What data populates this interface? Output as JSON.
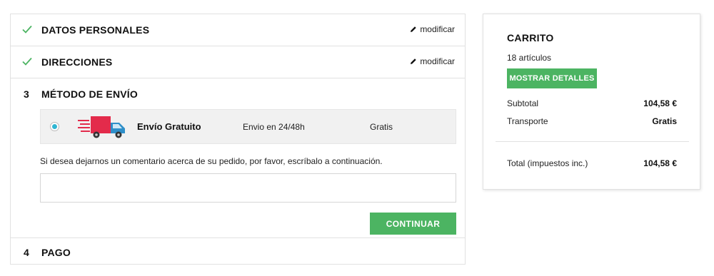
{
  "steps": [
    {
      "label": "DATOS PERSONALES",
      "status": "done",
      "action": "modificar"
    },
    {
      "label": "DIRECCIONES",
      "status": "done",
      "action": "modificar"
    },
    {
      "number": "3",
      "label": "MÉTODO DE ENVÍO",
      "status": "current"
    },
    {
      "number": "4",
      "label": "PAGO",
      "status": "pending"
    }
  ],
  "shipping": {
    "carrier_name": "Envío Gratuito",
    "delay": "Envio en 24/48h",
    "price": "Gratis",
    "selected": true,
    "icon": "delivery-truck-icon",
    "comment_label": "Si desea dejarnos un comentario acerca de su pedido, por favor, escríbalo a continuación.",
    "comment_value": "",
    "continue_label": "CONTINUAR"
  },
  "cart": {
    "title": "CARRITO",
    "item_count": "18 artículos",
    "details_button": "MOSTRAR DETALLES",
    "subtotal_label": "Subtotal",
    "subtotal_value": "104,58 €",
    "shipping_label": "Transporte",
    "shipping_value": "Gratis",
    "total_label": "Total (impuestos inc.)",
    "total_value": "104,58 €"
  },
  "colors": {
    "accent_green": "#4cb462",
    "check_green": "#4cb462",
    "radio_blue": "#2fb5d2",
    "truck_red": "#e32b4b",
    "truck_blue": "#2f8fc9"
  }
}
